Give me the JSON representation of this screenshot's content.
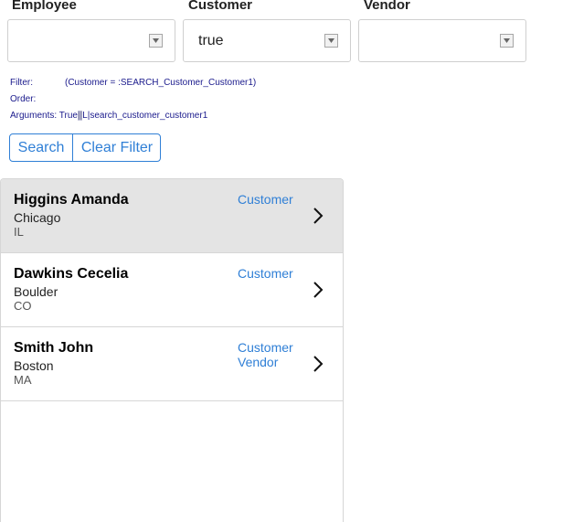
{
  "filters": {
    "employee": {
      "label": "Employee",
      "value": ""
    },
    "customer": {
      "label": "Customer",
      "value": "true"
    },
    "vendor": {
      "label": "Vendor",
      "value": ""
    }
  },
  "query": {
    "filter_label": "Filter:",
    "filter_value": "(Customer = :SEARCH_Customer_Customer1)",
    "order_label": "Order:",
    "order_value": "",
    "arguments_label": "Arguments:",
    "arguments_pre": "True",
    "arguments_sep": "||",
    "arguments_mid": "L",
    "arguments_post": "|search_customer_customer1"
  },
  "buttons": {
    "search": "Search",
    "clear": "Clear Filter"
  },
  "results": [
    {
      "name": "Higgins Amanda",
      "city": "Chicago",
      "state": "IL",
      "roles": [
        "Customer"
      ]
    },
    {
      "name": "Dawkins Cecelia",
      "city": "Boulder",
      "state": "CO",
      "roles": [
        "Customer"
      ]
    },
    {
      "name": "Smith John",
      "city": "Boston",
      "state": "MA",
      "roles": [
        "Customer",
        "Vendor"
      ]
    }
  ]
}
